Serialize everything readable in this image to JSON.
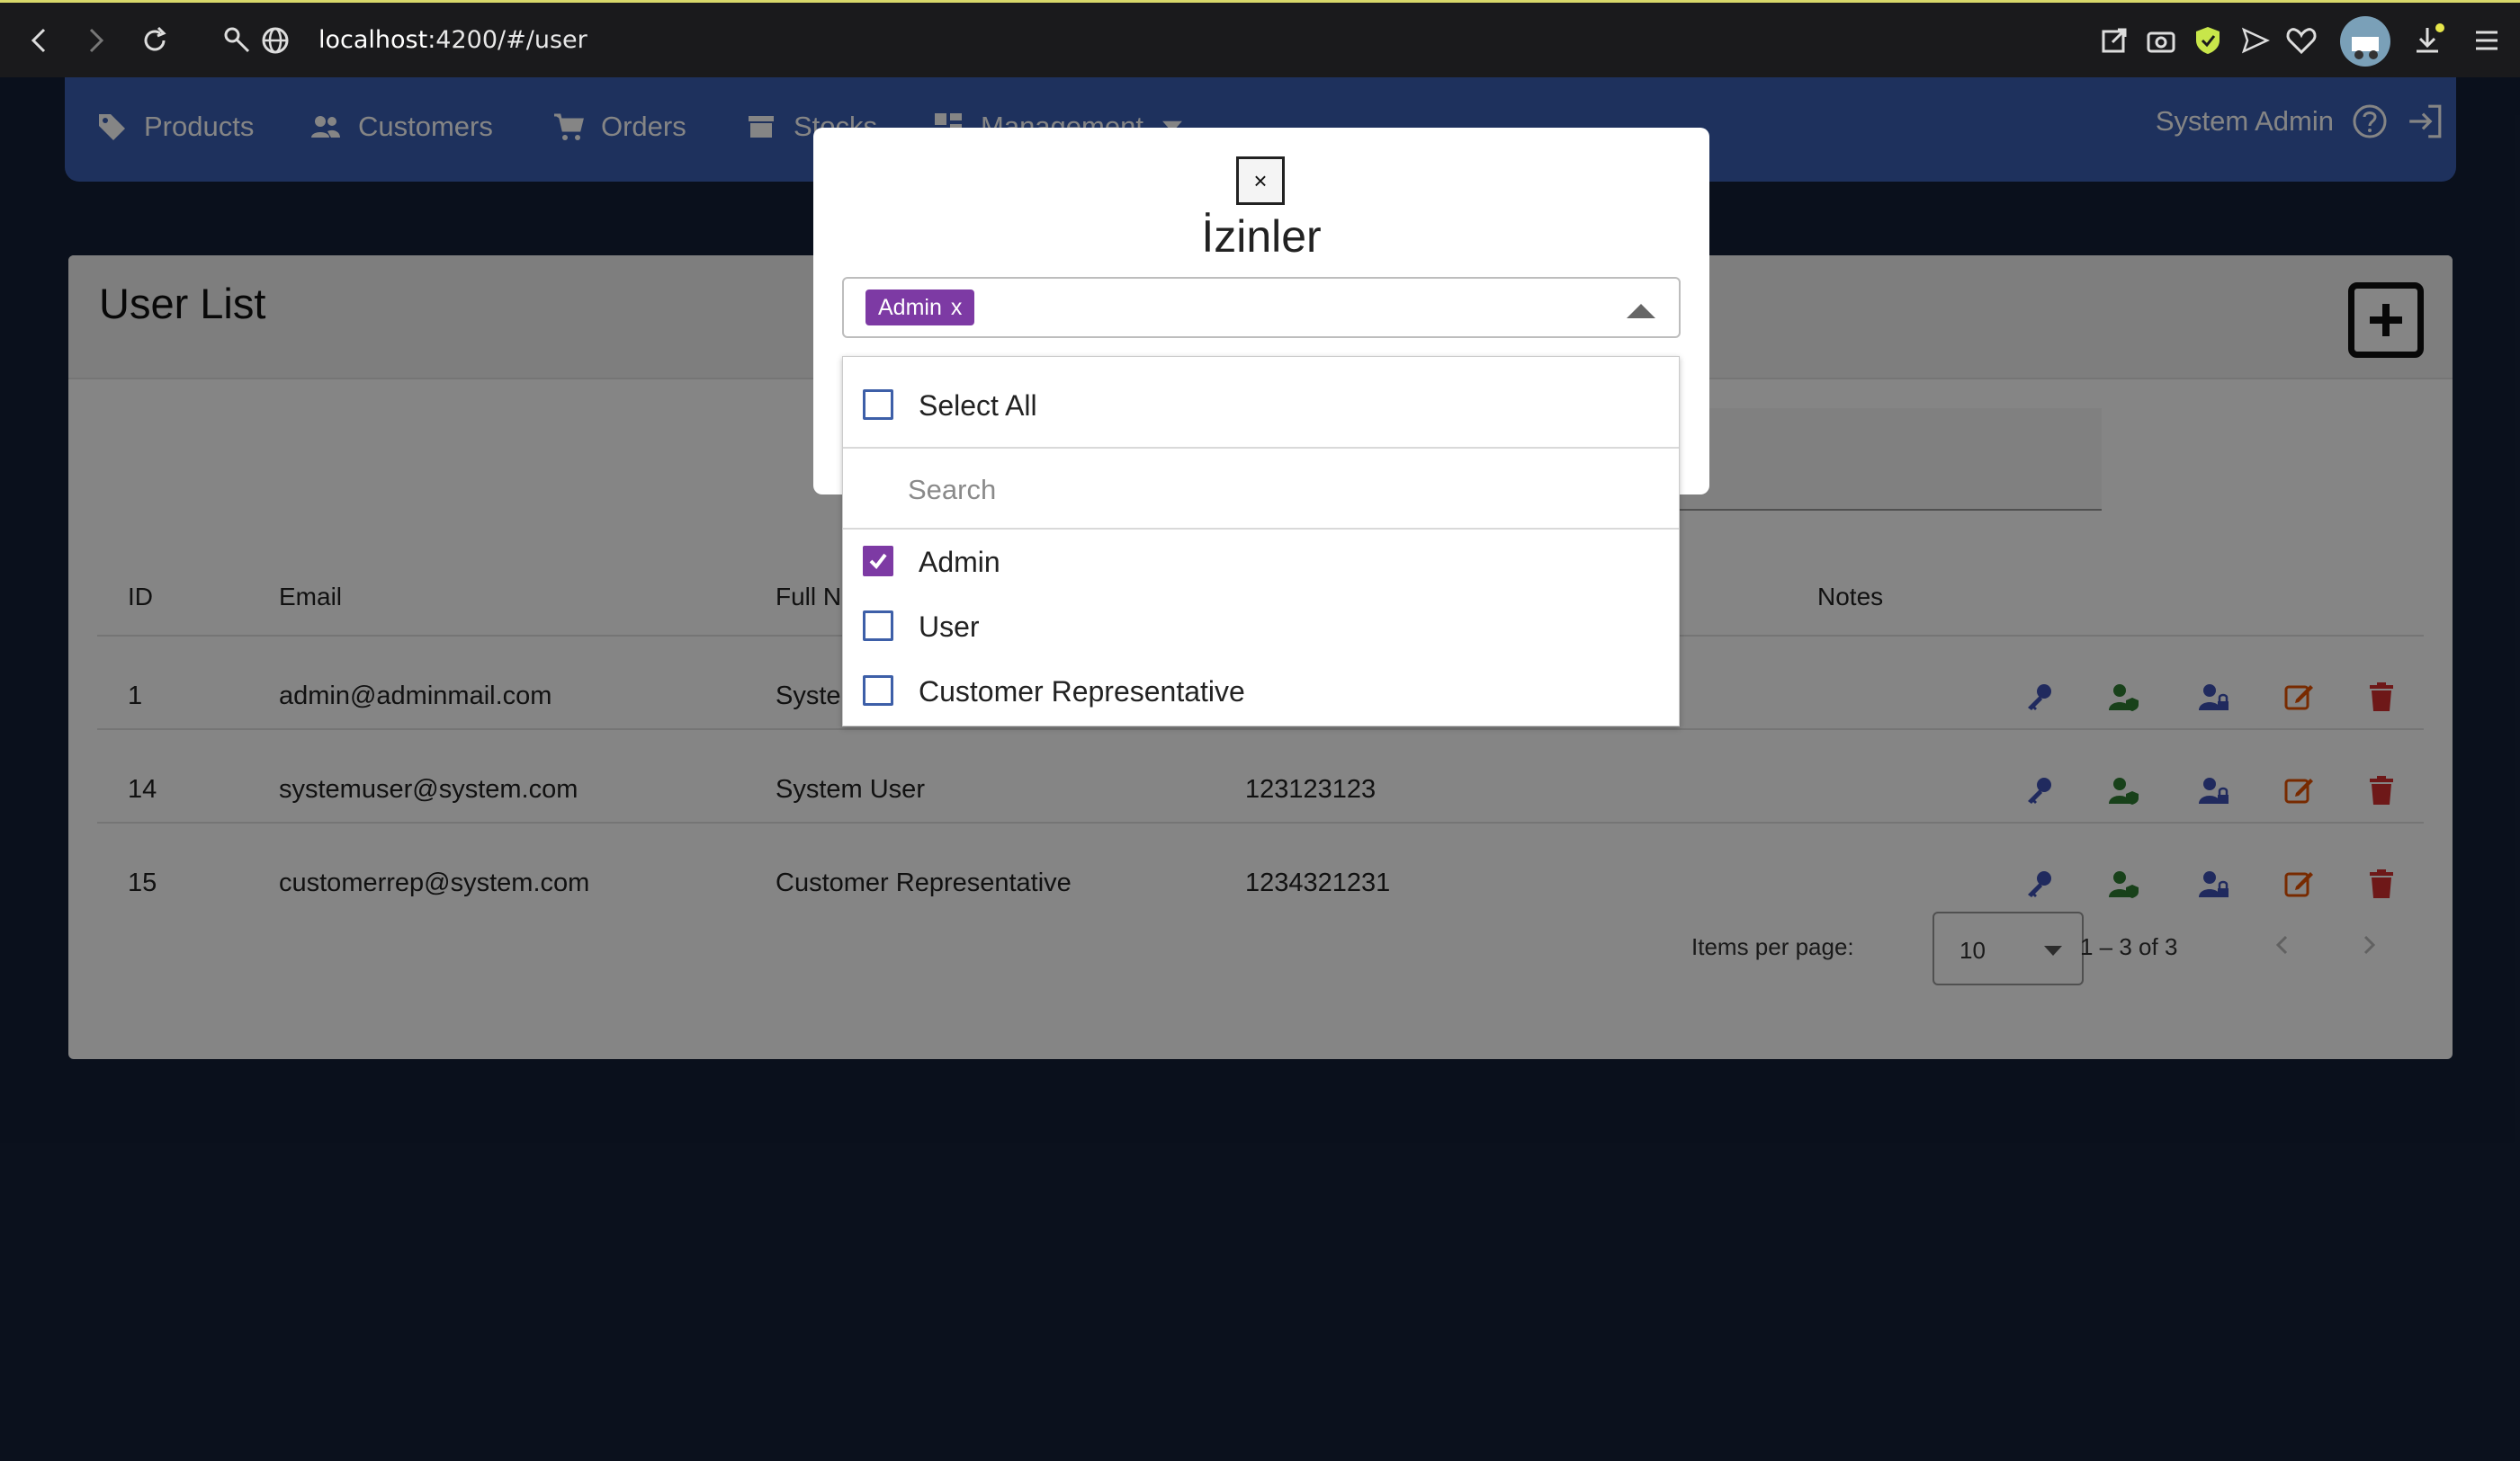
{
  "browser": {
    "url_host": "localhost",
    "url_rest": ":4200/#/user"
  },
  "nav": {
    "items": [
      {
        "label": "Products",
        "icon": "tag-icon"
      },
      {
        "label": "Customers",
        "icon": "users-icon"
      },
      {
        "label": "Orders",
        "icon": "cart-icon"
      },
      {
        "label": "Stocks",
        "icon": "store-icon"
      },
      {
        "label": "Management",
        "icon": "dashboard-icon"
      }
    ],
    "user": "System Admin"
  },
  "page": {
    "title": "User List",
    "columns": [
      "ID",
      "Email",
      "Full N",
      "Notes"
    ],
    "rows": [
      {
        "id": "1",
        "email": "admin@adminmail.com",
        "full_name": "Syste",
        "phone": ""
      },
      {
        "id": "14",
        "email": "systemuser@system.com",
        "full_name": "System User",
        "phone": "123123123"
      },
      {
        "id": "15",
        "email": "customerrep@system.com",
        "full_name": "Customer Representative",
        "phone": "1234321231"
      }
    ],
    "pager": {
      "items_per_page_label": "Items per page:",
      "items_per_page": "10",
      "range": "1 – 3 of 3"
    }
  },
  "modal": {
    "close_label": "×",
    "title": "İzinler",
    "selected_chip": "Admin",
    "chip_remove": "x",
    "dropdown": {
      "select_all": "Select All",
      "search_placeholder": "Search",
      "options": [
        {
          "label": "Admin",
          "checked": true
        },
        {
          "label": "User",
          "checked": false
        },
        {
          "label": "Customer Representative",
          "checked": false
        }
      ]
    }
  },
  "colors": {
    "page_bg": "#152037",
    "nav_bg": "#3b5eb3",
    "chip_bg": "#7d3aa4",
    "key_icon": "#3f51b5",
    "role_icon_green": "#2e7d32",
    "edit_icon": "#e65100",
    "delete_icon": "#d32f2f"
  }
}
